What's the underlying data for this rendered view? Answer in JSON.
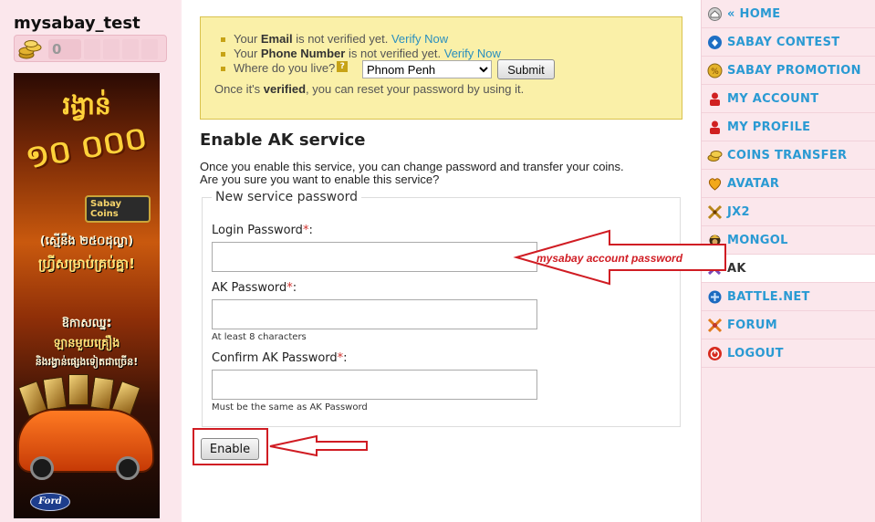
{
  "user": {
    "username": "mysabay_test",
    "coins": "0"
  },
  "banner": {
    "headline1": "រង្វាន់",
    "headline2": "១០ ០០០",
    "badge": "Sabay Coins",
    "line1": "(ស្មើនឹង ២៥០ដុល្លា)",
    "line2": "ហ្វ្រីសម្រាប់គ្រប់គ្នា!",
    "line3": "ឱកាសឈ្នះ",
    "line4": "ឡានមួយគ្រឿង",
    "line5": "និងរង្វាន់ផ្សេងទៀតជាច្រើន!",
    "ford": "Ford"
  },
  "notice": {
    "email_pre": "Your ",
    "email_bold": "Email",
    "email_post": " is not verified yet. ",
    "email_link": "Verify Now",
    "phone_pre": "Your ",
    "phone_bold": "Phone Number",
    "phone_post": " is not verified yet. ",
    "phone_link": "Verify Now",
    "where_label": "Where do you live?",
    "help_icon": "?",
    "location_selected": "Phnom Penh",
    "submit_label": "Submit",
    "reset_pre": "Once it's ",
    "reset_bold": "verified",
    "reset_post": ", you can reset your password by using it."
  },
  "form": {
    "title": "Enable AK service",
    "intro_line1": "Once you enable this service, you can change password and transfer your coins.",
    "intro_line2": "Are you sure you want to enable this service?",
    "legend": "New service password",
    "login_password_label": "Login Password",
    "ak_password_label": "AK Password",
    "ak_password_hint": "At least 8 characters",
    "confirm_label": "Confirm AK Password",
    "confirm_hint": "Must be the same as AK Password",
    "required_mark": "*",
    "colon": ":",
    "enable_label": "Enable"
  },
  "annotation": {
    "text": "mysabay account password",
    "color": "#d01c23"
  },
  "nav": {
    "items": [
      {
        "label": "« HOME",
        "icon": "home-icon"
      },
      {
        "label": "SABAY CONTEST",
        "icon": "contest-icon"
      },
      {
        "label": "SABAY PROMOTION",
        "icon": "promotion-icon"
      },
      {
        "label": "MY ACCOUNT",
        "icon": "account-icon"
      },
      {
        "label": "MY PROFILE",
        "icon": "profile-icon"
      },
      {
        "label": "COINS TRANSFER",
        "icon": "coins-icon"
      },
      {
        "label": "AVATAR",
        "icon": "avatar-icon"
      },
      {
        "label": "JX2",
        "icon": "jx2-icon"
      },
      {
        "label": "MONGOL",
        "icon": "mongol-icon"
      },
      {
        "label": "AK",
        "icon": "ak-icon",
        "active": true
      },
      {
        "label": "BATTLE.NET",
        "icon": "battlenet-icon"
      },
      {
        "label": "FORUM",
        "icon": "forum-icon"
      },
      {
        "label": "LOGOUT",
        "icon": "logout-icon"
      }
    ]
  },
  "colors": {
    "link": "#2a9ad3",
    "accent_red": "#d01c23",
    "notice_bg": "#faf0a8",
    "page_bg": "#fbe9ee"
  }
}
